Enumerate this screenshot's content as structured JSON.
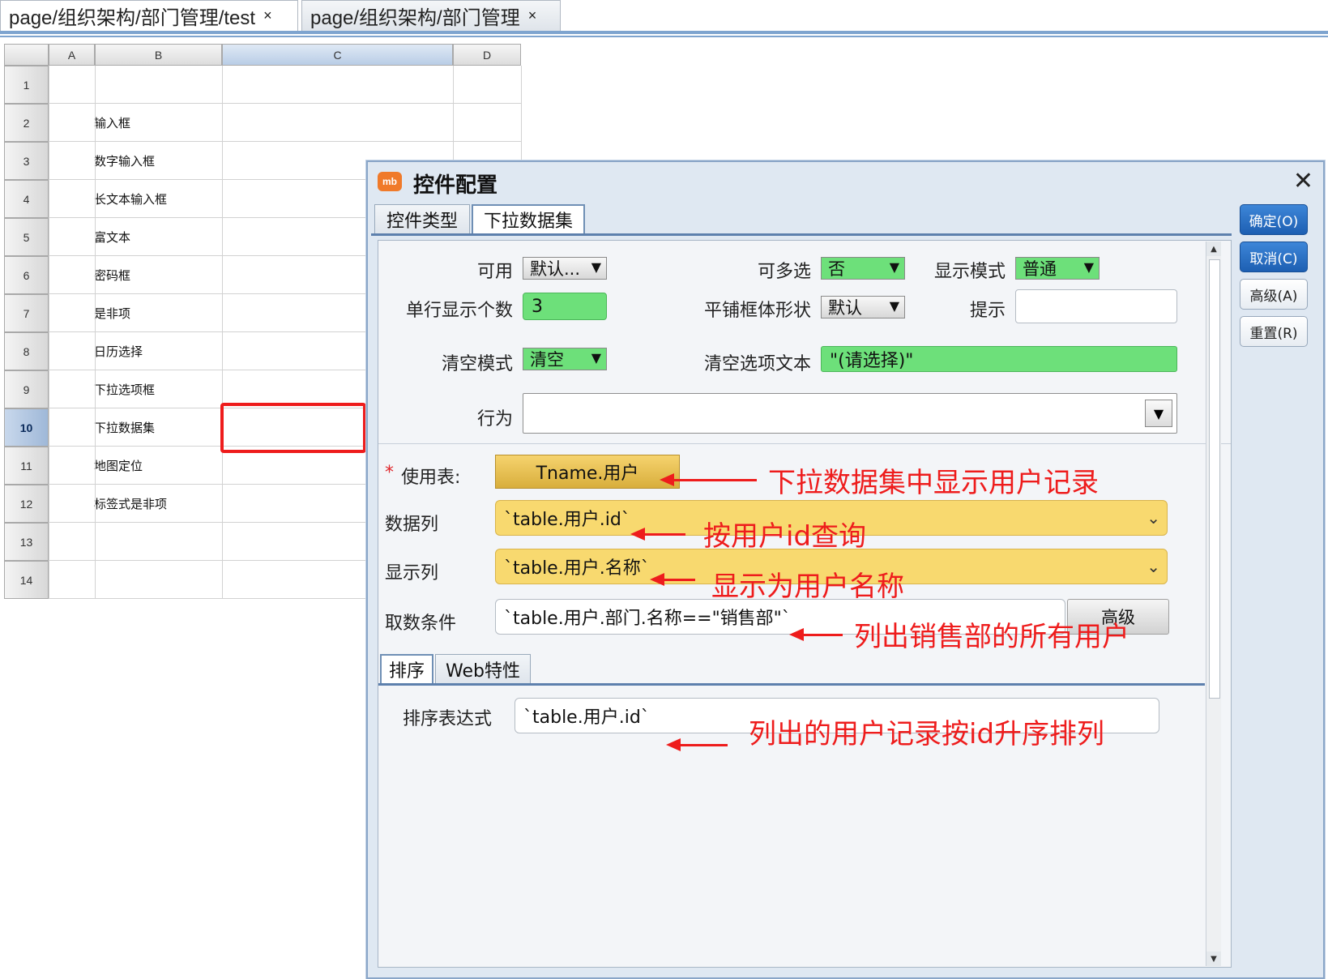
{
  "editor_tabs": [
    {
      "label": "page/组织架构/部门管理/test",
      "close": "×"
    },
    {
      "label": "page/组织架构/部门管理",
      "close": "×"
    }
  ],
  "sheet": {
    "columns": [
      "A",
      "B",
      "C",
      "D"
    ],
    "rows": [
      "1",
      "2",
      "3",
      "4",
      "5",
      "6",
      "7",
      "8",
      "9",
      "10",
      "11",
      "12",
      "13",
      "14"
    ],
    "cells_b": [
      "",
      "输入框",
      "数字输入框",
      "长文本输入框",
      "富文本",
      "密码框",
      "是非项",
      "日历选择",
      "下拉选项框",
      "下拉数据集",
      "地图定位",
      "标签式是非项",
      "",
      ""
    ],
    "selected_row": "10",
    "selected_column": "C"
  },
  "dialog": {
    "logo": "mb",
    "title": "控件配置",
    "close": "✕",
    "tabs": [
      "控件类型",
      "下拉数据集"
    ],
    "side_buttons": {
      "ok": "确定(O)",
      "cancel": "取消(C)",
      "advanced": "高级(A)",
      "reset": "重置(R)"
    },
    "form": {
      "enabled_label": "可用",
      "enabled_value": "默认...",
      "multi_label": "可多选",
      "multi_value": "否",
      "display_mode_label": "显示模式",
      "display_mode_value": "普通",
      "per_row_label": "单行显示个数",
      "per_row_value": "3",
      "tile_shape_label": "平铺框体形状",
      "tile_shape_value": "默认",
      "hint_label": "提示",
      "hint_value": "",
      "clear_mode_label": "清空模式",
      "clear_mode_value": "清空",
      "clear_text_label": "清空选项文本",
      "clear_text_value": "\"(请选择)\"",
      "behavior_label": "行为",
      "behavior_value": "",
      "required_mark": "*",
      "table_label": "使用表:",
      "table_value": "Tname.用户",
      "data_col_label": "数据列",
      "data_col_value": "`table.用户.id`",
      "display_col_label": "显示列",
      "display_col_value": "`table.用户.名称`",
      "condition_label": "取数条件",
      "condition_value": "`table.用户.部门.名称==\"销售部\"`",
      "condition_button": "高级"
    },
    "inner_tabs": [
      "排序",
      "Web特性"
    ],
    "sort_label": "排序表达式",
    "sort_value": "`table.用户.id`"
  },
  "annotations": {
    "table": "下拉数据集中显示用户记录",
    "data_col": "按用户id查询",
    "display_col": "显示为用户名称",
    "condition": "列出销售部的所有用户",
    "sort": "列出的用户记录按id升序排列"
  },
  "colors": {
    "accent": "#1d5fb2",
    "highlight_green": "#6de07a",
    "highlight_yellow": "#f8d96f",
    "annotation_red": "#ee1c1c"
  }
}
